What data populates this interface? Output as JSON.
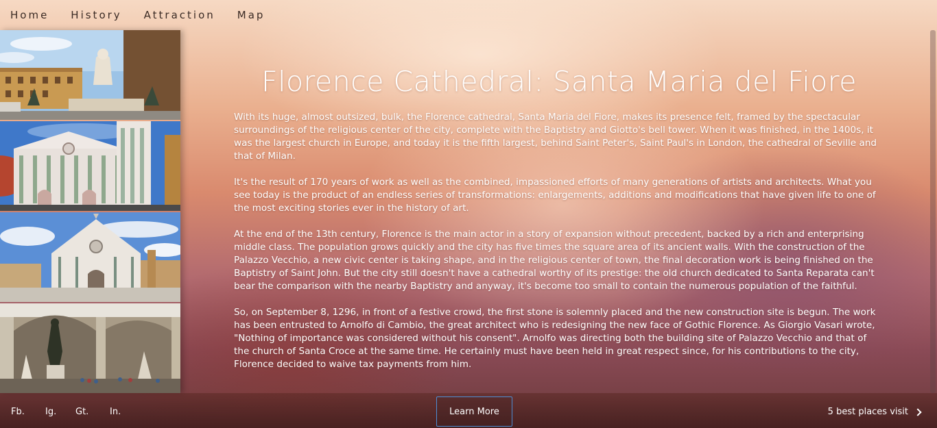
{
  "nav": {
    "items": [
      "Home",
      "History",
      "Attraction",
      "Map"
    ]
  },
  "article": {
    "title": "Florence Cathedral: Santa Maria del Fiore",
    "paragraphs": [
      "With its huge, almost outsized, bulk, the Florence cathedral, Santa Maria del Fiore, makes its presence felt, framed by the spectacular surroundings of the religious center of the city, complete with the Baptistry and Giotto's bell tower. When it was finished, in the 1400s, it was the largest church in Europe, and today it is the fifth largest, behind Saint Peter's, Saint Paul's in London, the cathedral of Seville and that of Milan.",
      "It's the result of 170 years of work as well as the combined, impassioned efforts of many generations of artists and architects. What you see today is the product of an endless series of transformations: enlargements, additions and modifications that have given life to one of the most exciting stories ever in the history of art.",
      "At the end of the 13th century, Florence is the main actor in a story of expansion without precedent, backed by a rich and enterprising middle class. The population grows quickly and the city has five times the square area of its ancient walls. With the construction of the Palazzo Vecchio, a new civic center is taking shape, and in the religious center of town, the final decoration work is being finished on the Baptistry of Saint John. But the city still doesn't have a cathedral worthy of its prestige: the old church dedicated to Santa Reparata can't bear the comparison with the nearby Baptistry and anyway, it's become too small to contain the numerous population of the faithful.",
      "So, on September 8, 1296, in front of a festive crowd, the first stone is solemnly placed and the new construction site is begun. The work has been entrusted to Arnolfo di Cambio, the great architect who is redesigning the new face of Gothic Florence. As Giorgio Vasari wrote, \"Nothing of importance was considered without his consent\". Arnolfo was directing both the building site of Palazzo Vecchio and that of the church of Santa Croce at the same time. He certainly must have been held in great respect since, for his contributions to the city, Florence decided to waive tax payments from him."
    ]
  },
  "footer": {
    "social": [
      "Fb.",
      "Ig.",
      "Gt.",
      "In."
    ],
    "learn_more": "Learn More",
    "next_link": "5 best places visit"
  },
  "gallery": {
    "images": [
      "piazza-della-signoria-photo",
      "florence-cathedral-photo",
      "santa-croce-photo",
      "loggia-dei-lanzi-photo"
    ]
  },
  "colors": {
    "nav_text": "#3a2a24",
    "button_border": "#4d8fd6",
    "text": "#ffffff"
  }
}
